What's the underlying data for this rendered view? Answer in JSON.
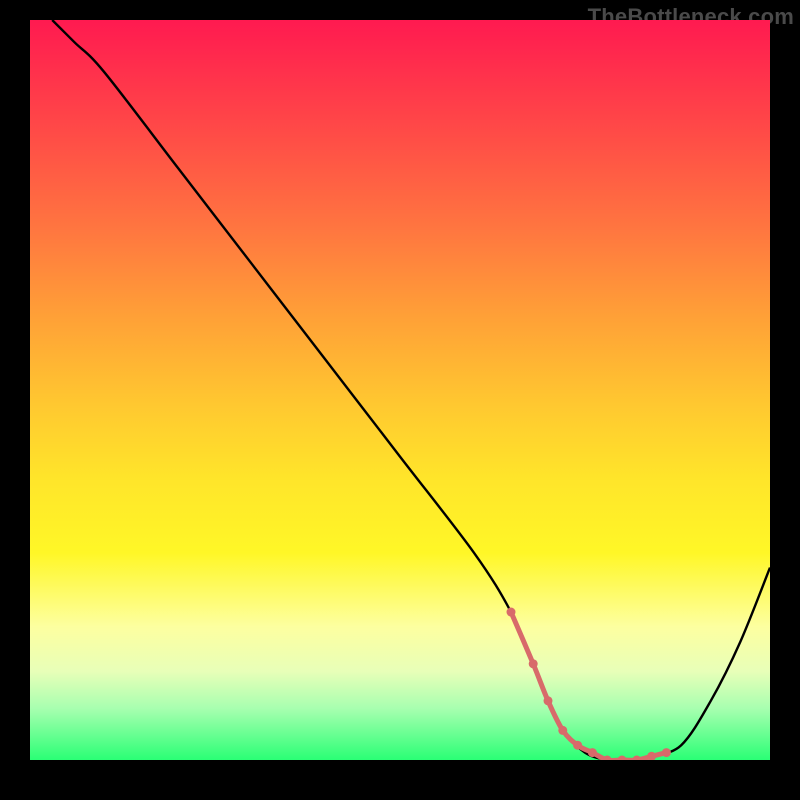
{
  "watermark": "TheBottleneck.com",
  "colors": {
    "curve": "#000000",
    "marker": "#d86a6a"
  },
  "chart_data": {
    "type": "line",
    "title": "",
    "xlabel": "",
    "ylabel": "",
    "xlim": [
      0,
      100
    ],
    "ylim": [
      0,
      100
    ],
    "grid": false,
    "x": [
      3,
      6,
      10,
      20,
      30,
      40,
      50,
      60,
      65,
      68,
      70,
      72,
      75,
      78,
      80,
      82,
      84,
      88,
      92,
      96,
      100
    ],
    "values": [
      100,
      97,
      93,
      80,
      67,
      54,
      41,
      28,
      20,
      13,
      8,
      4,
      1,
      0,
      0,
      0,
      0.5,
      2,
      8,
      16,
      26
    ],
    "sweet_spot_markers_x": [
      65,
      68,
      70,
      72,
      74,
      76,
      78,
      80,
      82,
      84,
      86
    ],
    "sweet_spot_markers_y": [
      20,
      13,
      8,
      4,
      2,
      1,
      0,
      0,
      0,
      0.5,
      1
    ]
  }
}
